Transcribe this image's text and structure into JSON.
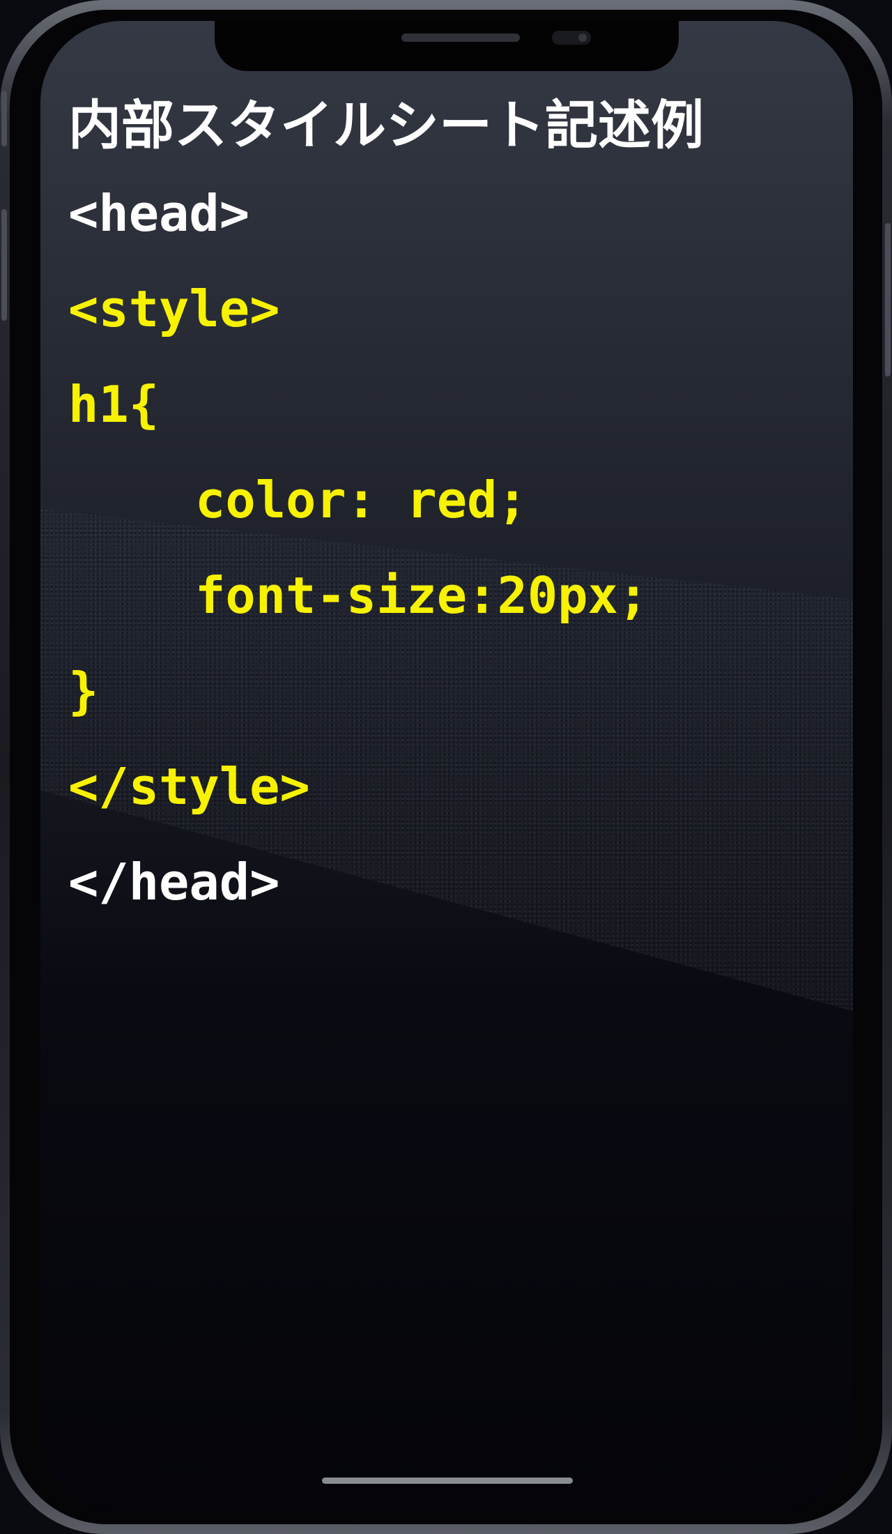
{
  "title": "内部スタイルシート記述例",
  "colors": {
    "tag_white": "#ffffff",
    "code_yellow": "#f7f200"
  },
  "code": {
    "head_open": "<head>",
    "style_open": "<style>",
    "selector": "h1{",
    "decl_color": "color: red;",
    "decl_font_size": "font-size:20px;",
    "brace_close": "}",
    "style_close": "</style>",
    "head_close": "</head>"
  }
}
